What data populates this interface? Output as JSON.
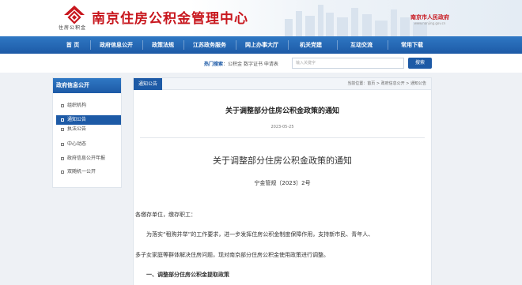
{
  "header": {
    "logo_sub": "住房公积金",
    "site_title": "南京住房公积金管理中心",
    "gov_name": "南京市人民政府",
    "gov_url": "www.nanjing.gov.cn"
  },
  "nav": [
    "首 页",
    "政府信息公开",
    "政策法规",
    "江苏政务服务",
    "网上办事大厅",
    "机关党建",
    "互动交流",
    "常用下载"
  ],
  "hot_search": {
    "label": "热门搜索",
    "terms": "公积金 数字证书 申请表",
    "placeholder": "输入关键字",
    "button": "搜索"
  },
  "sidebar": {
    "heading": "政府信息公开",
    "items": [
      {
        "label": "组织机构",
        "active": false
      },
      {
        "label": "通知公告",
        "active": true
      },
      {
        "label": "执法公告",
        "active": false
      },
      {
        "label": "中心动态",
        "active": false
      },
      {
        "label": "政府信息公开年报",
        "active": false
      },
      {
        "label": "双随机一公开",
        "active": false
      }
    ]
  },
  "tab": "通知公告",
  "breadcrumb": {
    "prefix": "当前位置：",
    "path": "首页 > 政府信息公开 > 通知公告"
  },
  "article": {
    "title": "关于调整部分住房公积金政策的通知",
    "date": "2023-05-25",
    "subtitle": "关于调整部分住房公积金政策的通知",
    "doc_number": "宁金管规〔2023〕2号",
    "salutation": "各缴存单位，缴存职工：",
    "para1_line1": "为落实“租购并举”的工作要求，进一步发挥住房公积金制度保障作用，支持新市民、青年人、",
    "para1_line2": "多子女家庭等群体解决住房问题，现对南京部分住房公积金使用政策进行调整。",
    "section1": "一、调整部分住房公积金提取政策"
  },
  "colors": {
    "brand_red": "#c8171e",
    "nav_blue": "#1d5aa6"
  }
}
